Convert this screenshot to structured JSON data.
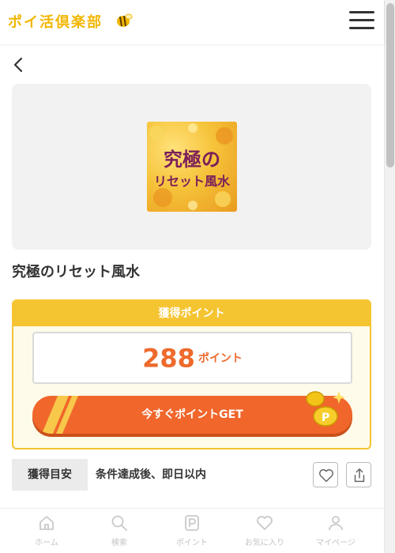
{
  "header": {
    "logo_text": "ポイ活倶楽部",
    "logo_icon": "bee-icon",
    "menu_icon": "hamburger-menu-icon"
  },
  "nav": {
    "back_icon": "chevron-left-icon"
  },
  "offer": {
    "thumbnail_line1": "究極の",
    "thumbnail_line2": "リセット風水",
    "title": "究極のリセット風水"
  },
  "points": {
    "header": "獲得ポイント",
    "value": "288",
    "unit": "ポイント",
    "cta_label": "今すぐポイントGET",
    "cta_color": "#f0662b",
    "accent_color": "#f5c431"
  },
  "condition": {
    "label": "獲得目安",
    "text": "条件達成後、即日以内",
    "favorite_icon": "heart-icon",
    "share_icon": "share-icon"
  },
  "bottom_nav": {
    "items": [
      {
        "label": "ホーム",
        "icon": "home-icon"
      },
      {
        "label": "検索",
        "icon": "search-icon"
      },
      {
        "label": "ポイント",
        "icon": "point-icon"
      },
      {
        "label": "お気に入り",
        "icon": "heart-icon"
      },
      {
        "label": "マイページ",
        "icon": "user-icon"
      }
    ]
  }
}
